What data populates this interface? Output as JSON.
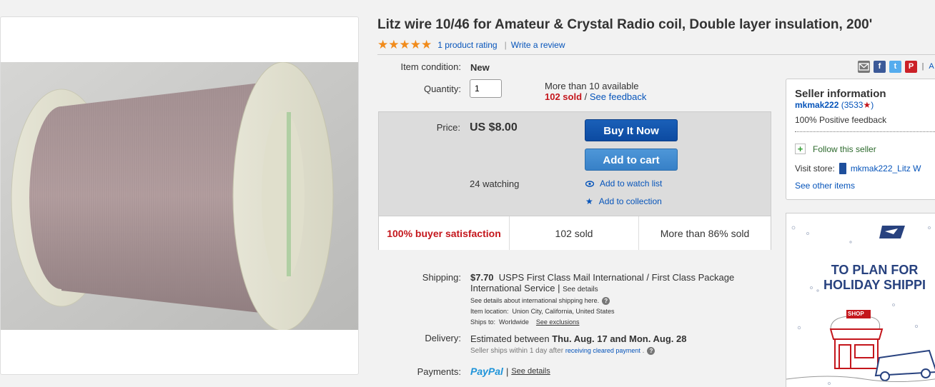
{
  "listing": {
    "title": "Litz wire 10/46 for Amateur & Crystal Radio coil, Double layer insulation, 200'",
    "stars": "★★★★★",
    "rating_link": "1 product rating",
    "rating_sep": "|",
    "review_link": "Write a review"
  },
  "details": {
    "condition_label": "Item condition:",
    "condition_value": "New",
    "quantity_label": "Quantity:",
    "quantity_value": "1",
    "available": "More than 10 available",
    "sold": "102 sold",
    "sold_sep": " / ",
    "feedback_link": "See feedback"
  },
  "buybox": {
    "price_label": "Price:",
    "price": "US $8.00",
    "buy_now": "Buy It Now",
    "add_to_cart": "Add to cart",
    "watching": "24 watching",
    "watch_list": "Add to watch list",
    "collection": "Add to collection",
    "stats": [
      "100% buyer satisfaction",
      "102 sold",
      "More than 86% sold"
    ]
  },
  "shipping": {
    "label": "Shipping:",
    "cost": "$7.70",
    "service_line1": "USPS First Class Mail International / First Class Package",
    "service_line2": "International Service |",
    "see_details": "See details",
    "intl_note": "See details about international shipping here.",
    "location_label": "Item location:",
    "location": "Union City, California, United States",
    "ships_label": "Ships to:",
    "ships_to": "Worldwide",
    "exclusions": "See exclusions"
  },
  "delivery": {
    "label": "Delivery:",
    "prefix": "Estimated between ",
    "range": "Thu. Aug. 17 and Mon. Aug. 28",
    "note_prefix": "Seller ships within 1 day after ",
    "note_link": "receiving cleared payment",
    "note_suffix": " ."
  },
  "payments": {
    "label": "Payments:",
    "paypal": "PayPal",
    "sep": "|",
    "see_details": "See details"
  },
  "social": {
    "icons": [
      "email-icon",
      "facebook-icon",
      "twitter-icon",
      "pinterest-icon"
    ],
    "fb": "f",
    "tw": "t",
    "pin": "P",
    "sep": "|",
    "more": "A"
  },
  "seller": {
    "heading": "Seller information",
    "name": "mkmak222",
    "score": "(3533",
    "score_close": ")",
    "positive": "100% Positive feedback",
    "follow": "Follow this seller",
    "visit_label": "Visit store:",
    "store": "mkmak222_Litz W",
    "other_items": "See other items"
  },
  "ad": {
    "line1": "TO PLAN FOR",
    "line2": "HOLIDAY SHIPPI",
    "shop_sign": "SHOP"
  },
  "colors": {
    "link": "#0654ba",
    "star": "#f18b1b",
    "sold_red": "#c4161c",
    "buy_button": "#0c4aa1",
    "cart_button": "#3780c7",
    "usps_blue": "#28427f"
  }
}
